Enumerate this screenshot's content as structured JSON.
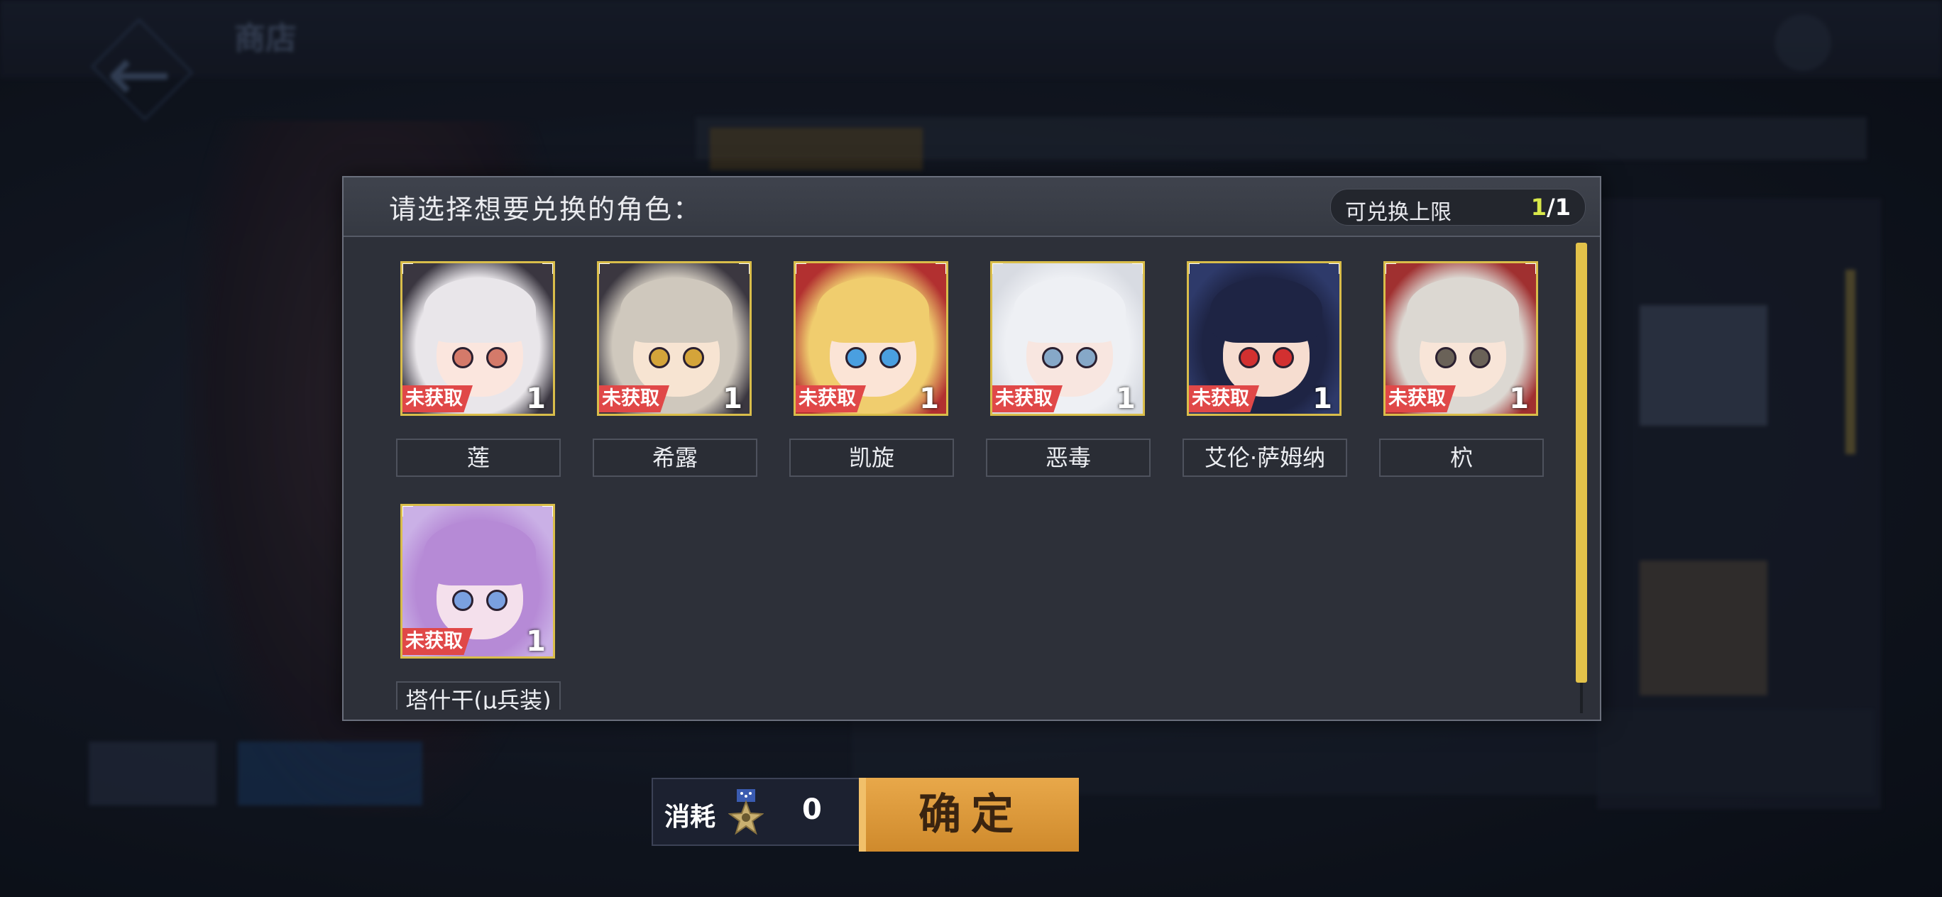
{
  "background": {
    "screen_title": "商店"
  },
  "dialog": {
    "title": "请选择想要兑换的角色：",
    "limit": {
      "label": "可兑换上限",
      "current": "1",
      "max": "/1"
    }
  },
  "badge_text": "未获取",
  "characters": [
    {
      "name": "莲",
      "count": "1",
      "hair": "#e9e6ea",
      "skin": "#fbe6de",
      "eye": "#d47a6a",
      "bg": "#3a3640",
      "status": "未获取"
    },
    {
      "name": "希露",
      "count": "1",
      "hair": "#cfc8bd",
      "skin": "#f7e4d2",
      "eye": "#d4a43a",
      "bg": "#3b3740",
      "status": "未获取"
    },
    {
      "name": "凯旋",
      "count": "1",
      "hair": "#f0cd6e",
      "skin": "#fbe4d6",
      "eye": "#4a9fe0",
      "bg": "#b23030",
      "status": "未获取"
    },
    {
      "name": "恶毒",
      "count": "1",
      "hair": "#eef0f4",
      "skin": "#f8e6e0",
      "eye": "#86a8c8",
      "bg": "#d8dbe2",
      "status": "未获取"
    },
    {
      "name": "艾伦·萨姆纳",
      "count": "1",
      "hair": "#1e2444",
      "skin": "#f6ddd0",
      "eye": "#d23030",
      "bg": "#2e3a6a",
      "status": "未获取"
    },
    {
      "name": "柼",
      "count": "1",
      "hair": "#dcd8d2",
      "skin": "#f8e5d8",
      "eye": "#6a6258",
      "bg": "#a03030",
      "status": "未获取"
    },
    {
      "name": "塔什干(μ兵装)",
      "count": "1",
      "hair": "#b68ad6",
      "skin": "#f4e0ec",
      "eye": "#7aa0e0",
      "bg": "#cab0e6",
      "status": "未获取"
    }
  ],
  "cost": {
    "label": "消耗",
    "value": "0",
    "icon": "medal-icon"
  },
  "confirm": {
    "label": "确定"
  },
  "colors": {
    "accent_gold": "#e3c24a",
    "badge_red": "#e04848",
    "confirm_orange": "#dc9a3c"
  }
}
